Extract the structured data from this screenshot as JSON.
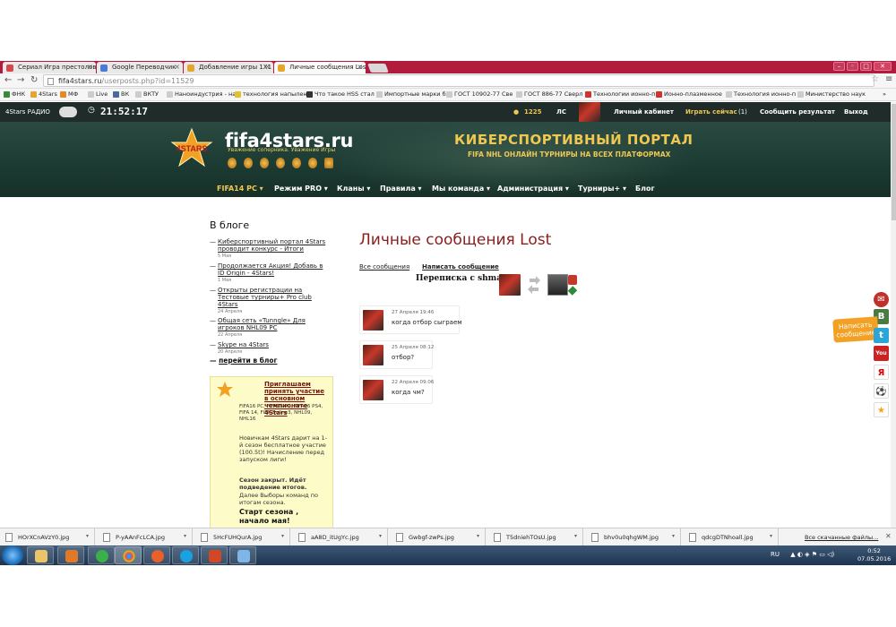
{
  "browser": {
    "tabs": [
      {
        "title": "Сериал Игра престолов",
        "icon_color": "#d34a4a"
      },
      {
        "title": "Google Переводчик",
        "icon_color": "#4a7ad3"
      },
      {
        "title": "Добавление игры 1Х1 о",
        "icon_color": "#e3a72f"
      },
      {
        "title": "Личные сообщения Lost",
        "icon_color": "#e3a72f"
      }
    ],
    "url_host": "fifa4stars.ru",
    "url_path": "/userposts.php?id=11529",
    "bookmarks": [
      "ФНК",
      "4Stars",
      "МФ",
      "Live",
      "ВК",
      "ВКТУ",
      "Наноиндустрия - на",
      "технология напылен",
      "Что такое HSS стал",
      "Импортные марки б",
      "ГОСТ 10902-77 Све",
      "ГОСТ 886-77 Сверл",
      "Технологии ионно-п",
      "Ионно-плазменное",
      "Технология ионно-п",
      "Министерство наук"
    ]
  },
  "site": {
    "radio_label": "4Stars РАДИО",
    "clock": "21:52:17",
    "coins": "1225",
    "ls_label": "ЛС",
    "cabinet_label": "Личный кабинет",
    "play_now_label": "Играть сейчас",
    "play_now_count": "(1)",
    "report_label": "Сообщить результат",
    "logout_label": "Выход",
    "logo_text": "fifa4stars.ru",
    "logo_tagline": "Уважение соперника. Уважение Игры",
    "logo_badge": "4STARS",
    "portal_title": "КИБЕРСПОРТИВНЫЙ ПОРТАЛ",
    "portal_subtitle": "FIFA   NHL   ОНЛАЙН ТУРНИРЫ НА ВСЕХ ПЛАТФОРМАХ",
    "nav": [
      "FIFA14 PC",
      "Режим PRO",
      "Кланы",
      "Правила",
      "Мы команда",
      "Администрация",
      "Турниры+",
      "Блог"
    ]
  },
  "blog": {
    "heading": "В блоге",
    "items": [
      {
        "title": "Киберспортивный портал 4Stars проводит конкурс - Итоги",
        "date": "5 Мая"
      },
      {
        "title": "Продолжается Акция! Добавь в ID Origin - 4Stars!",
        "date": "1 Мая"
      },
      {
        "title": "Открыты регистрации на Тестовые турниры+ Pro club 4Stars",
        "date": "24 Апреля"
      },
      {
        "title": "Общая сеть «Tunngle» Для игроков NHL09 PC",
        "date": "22 Апреля"
      },
      {
        "title": "Skype на 4Stars",
        "date": "20 Апреля"
      }
    ],
    "more": "перейти в блог"
  },
  "promo": {
    "title": "Приглашаем принять участие в основном чемпионате 4Stars",
    "platforms": "FIFA16 PC, FIFA15 PC, FIFA16 PS4, FIFA 14, FIFA Online3, NHL09, NHL16",
    "newbie": "Новичкам 4Stars дарит на 1-й сезон бесплатное участие (100.5t)! Начисление перед запуском лиги!",
    "closed": "Сезон закрыт. Идёт подведение итогов.",
    "closed_rest": "Далее Выборы команд по итогам сезона.",
    "start": "Старт сезона , начало мая!"
  },
  "pm": {
    "title": "Личные сообщения Lost",
    "tab_all": "Все сообщения",
    "tab_write": "Написать сообщение",
    "with_label": "Переписка с shmak",
    "messages": [
      {
        "date": "27 Апреля 19:46",
        "text": "когда отбор сыграем"
      },
      {
        "date": "25 Апреля 08:12",
        "text": "отбор?"
      },
      {
        "date": "22 Апреля 09:06",
        "text": "когда чм?"
      }
    ]
  },
  "social": {
    "write_label": "Написать сообщение",
    "icons": [
      "mail-icon",
      "vk-icon",
      "twitter-icon",
      "youtube-icon",
      "yandex-icon",
      "ball-icon",
      "star-icon"
    ]
  },
  "downloads": {
    "files": [
      "HOrXCnAVzY0.jpg",
      "P-yAAnFcLCA.jpg",
      "5HcFUHQurA.jpg",
      "aA8D_itUgYc.jpg",
      "Gwbgf-zwPs.jpg",
      "T5dniehTOsU.jpg",
      "bhv0u0qhgWM.jpg",
      "qdcgDTNhoall.jpg"
    ],
    "show_all": "Все скачанные файлы..."
  },
  "taskbar": {
    "lang": "RU",
    "time": "0:52",
    "date": "07.05.2016"
  },
  "colors": {
    "accent": "#f0c850",
    "title_red": "#8b1d1d",
    "header_bg": "#1f2c2a"
  }
}
